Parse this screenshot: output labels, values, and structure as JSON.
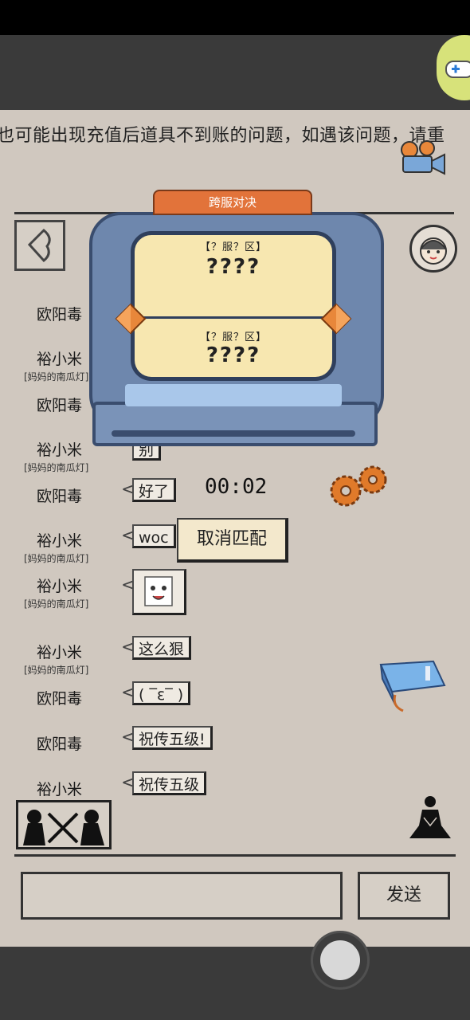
{
  "notice_text": "也可能出现充值后道具不到账的问题，如遇该问题，请重",
  "match_panel": {
    "title": "跨服对决",
    "top_server": "【？服？区】",
    "top_name": "????",
    "bottom_server": "【？服？区】",
    "bottom_name": "????"
  },
  "timer": "00:02",
  "cancel_label": "取消匹配",
  "chat": [
    {
      "name": "欧阳毒",
      "sub": "",
      "msg": ""
    },
    {
      "name": "裕小米",
      "sub": "[妈妈的南瓜灯]",
      "msg": ""
    },
    {
      "name": "欧阳毒",
      "sub": "",
      "msg": ""
    },
    {
      "name": "裕小米",
      "sub": "[妈妈的南瓜灯]",
      "msg": "别"
    },
    {
      "name": "欧阳毒",
      "sub": "",
      "msg": "好了"
    },
    {
      "name": "裕小米",
      "sub": "[妈妈的南瓜灯]",
      "msg": "woc"
    },
    {
      "name": "裕小米",
      "sub": "[妈妈的南瓜灯]",
      "msg": ""
    },
    {
      "name": "裕小米",
      "sub": "[妈妈的南瓜灯]",
      "msg": "这么狠"
    },
    {
      "name": "欧阳毒",
      "sub": "",
      "msg": "( ‾ε‾ )"
    },
    {
      "name": "欧阳毒",
      "sub": "",
      "msg": "祝传五级!"
    },
    {
      "name": "裕小米",
      "sub": "",
      "msg": "祝传五级"
    }
  ],
  "send_label": "发送",
  "input_value": "",
  "icons": {
    "back": "back-arrow-icon",
    "camera": "camera-icon",
    "avatar": "avatar-icon",
    "gears": "gears-icon",
    "book": "book-icon",
    "battle": "crossed-swords-icon",
    "meditate": "meditation-icon",
    "gamepad": "gamepad-icon"
  },
  "colors": {
    "paper": "#d0c8bf",
    "machine_blue": "#6e87ad",
    "screen_yellow": "#f7e7b0",
    "title_orange": "#e2733a",
    "button_cream": "#f3e8cc"
  }
}
